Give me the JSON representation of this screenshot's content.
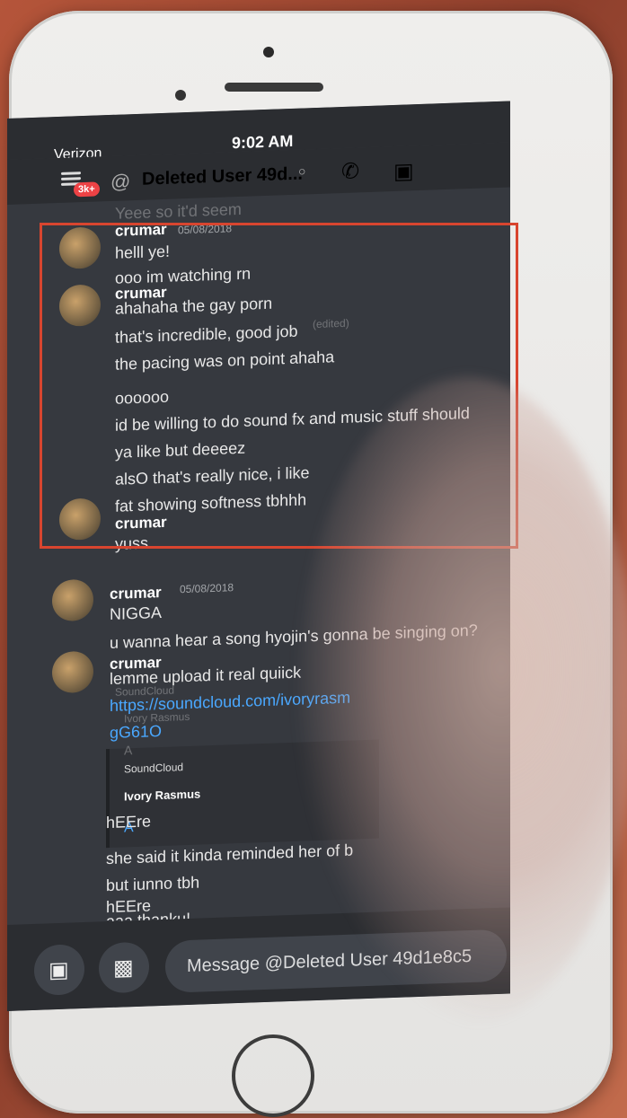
{
  "status_bar": {
    "carrier": "Verizon",
    "time": "9:02 AM"
  },
  "header": {
    "badge": "3k+",
    "at_symbol": "@",
    "title": "Deleted User 49d...",
    "status_dot": "○"
  },
  "messages": [
    {
      "username": "crumar",
      "timestamp": "05/08/2018",
      "lines": [
        "helll ye!",
        "ooo im watching rn"
      ]
    },
    {
      "username": "crumar",
      "timestamp": "",
      "lines": [
        "ahahaha the gay porn",
        "that's incredible, good job",
        "the pacing was on point ahaha",
        "oooooo",
        "id be willing to do sound fx and music stuff should",
        "ya like but deeeez",
        "alsO that's really nice, i like",
        "fat showing softness tbhhh"
      ]
    },
    {
      "username": "crumar",
      "timestamp": "",
      "lines": [
        "yuss"
      ]
    },
    {
      "username": "crumar",
      "timestamp": "05/08/2018",
      "lines": [
        "NIGGA",
        "u wanna hear a song hyojin's gonna be singing on?"
      ]
    },
    {
      "username": "crumar",
      "timestamp": "",
      "lines": [
        "lemme upload it real quiick"
      ],
      "link": "https://soundcloud.com/ivoryrasm",
      "link_tail": "gG61O",
      "embed": {
        "provider": "SoundCloud",
        "author": "Ivory Rasmus",
        "letter": "A"
      },
      "after_lines": [
        "hEEre",
        "she said it kinda reminded her of b",
        "but iunno tbh",
        "hEEre",
        "aaa thanku!"
      ]
    }
  ],
  "ghost_text": [
    "Yeee so it'd seem",
    "(edited)",
    "SoundCloud",
    "Ivory Rasmus",
    "A"
  ],
  "input": {
    "placeholder": "Message @Deleted User 49d1e8c5"
  },
  "colors": {
    "highlight": "#d8452f",
    "link": "#4aa8ff",
    "badge": "#ed4245"
  }
}
